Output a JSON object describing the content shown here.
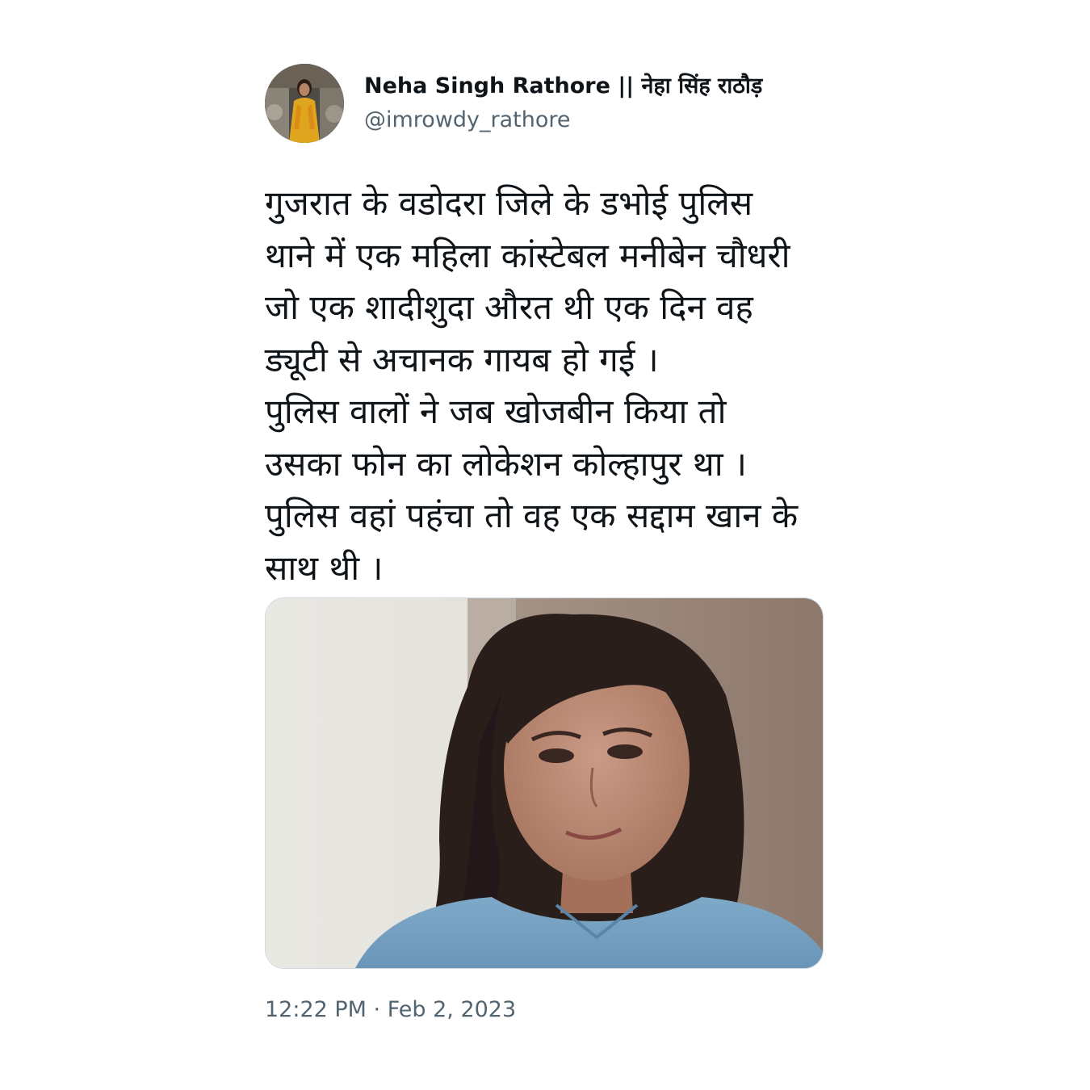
{
  "author": {
    "display_name": "Neha Singh Rathore || नेहा सिंह राठौड़",
    "handle": "@imrowdy_rathore",
    "avatar_icon": "profile-photo"
  },
  "tweet": {
    "lines": [
      "गुजरात के वडोदरा जिले के डभोई पुलिस",
      "थाने में एक महिला कांस्टेबल मनीबेन चौधरी",
      "जो एक शादीशुदा औरत थी एक दिन वह",
      "ड्यूटी से अचानक गायब हो गई ।",
      "पुलिस वालों ने जब खोजबीन किया तो",
      "उसका फोन का लोकेशन कोल्हापुर था ।",
      "पुलिस वहां पहंचा तो वह एक सद्दाम खान के",
      "साथ थी ।"
    ],
    "timestamp": "12:22 PM · Feb 2, 2023"
  },
  "colors": {
    "text_primary": "#0f1419",
    "text_secondary": "#536471",
    "media_border": "#cfd9de"
  }
}
